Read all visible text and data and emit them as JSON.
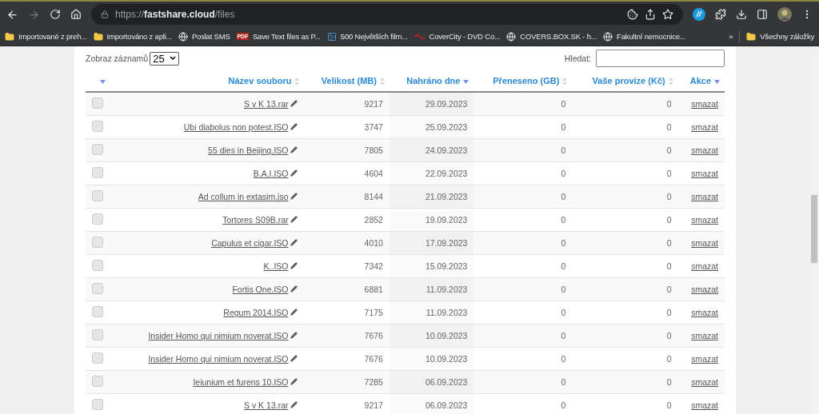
{
  "browser": {
    "url": "https://**fastshare.cloud**/files",
    "bookmarks": [
      {
        "kind": "folder",
        "label": "Importované z preh..."
      },
      {
        "kind": "folder",
        "label": "Importováno z apli..."
      },
      {
        "kind": "globe",
        "label": "Poslat SMS"
      },
      {
        "kind": "pdf",
        "label": "Save Text files as P...",
        "badge": "PDF"
      },
      {
        "kind": "image",
        "label": "500 Největších film..."
      },
      {
        "kind": "logo",
        "label": "CoverCity - DVD Co..."
      },
      {
        "kind": "globe",
        "label": "COVERS.BOX.SK - h..."
      },
      {
        "kind": "globe",
        "label": "Fakultní nemocnice..."
      }
    ],
    "overflow": "»",
    "all_bookmarks": "Všechny záložky"
  },
  "controls": {
    "page_size_label": "Zobraz záznamů",
    "page_size": "25",
    "search_label": "Hledat:"
  },
  "table": {
    "columns": [
      {
        "sorted": true
      },
      {
        "label": "Název souboru",
        "sorted": false
      },
      {
        "label": "Velikost (MB)",
        "sorted": false
      },
      {
        "label": "Nahráno dne",
        "sorted": true
      },
      {
        "label": "Přeneseno (GB)",
        "sorted": false
      },
      {
        "label": "Vaše provize (Kč)",
        "sorted": false
      },
      {
        "label": "Akce",
        "sorted": true
      }
    ],
    "rows": [
      {
        "checked": false,
        "name": "S v K 13.rar",
        "size": "9217",
        "date": "29.09.2023",
        "transferred": "0",
        "commission": "0",
        "action": "smazat"
      },
      {
        "checked": false,
        "name": "Ubi diabolus non potest.ISO",
        "size": "3747",
        "date": "25.09.2023",
        "transferred": "0",
        "commission": "0",
        "action": "smazat"
      },
      {
        "checked": false,
        "name": "55 dies in Beijing.ISO",
        "size": "7805",
        "date": "24.09.2023",
        "transferred": "0",
        "commission": "0",
        "action": "smazat"
      },
      {
        "checked": false,
        "name": "B.A.I.ISO",
        "size": "4604",
        "date": "22.09.2023",
        "transferred": "0",
        "commission": "0",
        "action": "smazat"
      },
      {
        "checked": false,
        "name": "Ad collum in extasim.iso",
        "size": "8144",
        "date": "21.09.2023",
        "transferred": "0",
        "commission": "0",
        "action": "smazat"
      },
      {
        "checked": false,
        "name": "Tortores S09B.rar",
        "size": "2852",
        "date": "19.09.2023",
        "transferred": "0",
        "commission": "0",
        "action": "smazat"
      },
      {
        "checked": false,
        "name": "Capulus et cigar.ISO",
        "size": "4010",
        "date": "17.09.2023",
        "transferred": "0",
        "commission": "0",
        "action": "smazat"
      },
      {
        "checked": false,
        "name": "K..ISO",
        "size": "7342",
        "date": "15.09.2023",
        "transferred": "0",
        "commission": "0",
        "action": "smazat"
      },
      {
        "checked": false,
        "name": "Fortis One.ISO",
        "size": "6881",
        "date": "11.09.2023",
        "transferred": "0",
        "commission": "0",
        "action": "smazat"
      },
      {
        "checked": false,
        "name": "Regum 2014.ISO",
        "size": "7175",
        "date": "11.09.2023",
        "transferred": "0",
        "commission": "0",
        "action": "smazat"
      },
      {
        "checked": false,
        "name": "Insider Homo qui nimium noverat.ISO",
        "size": "7676",
        "date": "10.09.2023",
        "transferred": "0",
        "commission": "0",
        "action": "smazat"
      },
      {
        "checked": false,
        "name": "Insider Homo qui nimium noverat.ISO",
        "size": "7676",
        "date": "10.09.2023",
        "transferred": "0",
        "commission": "0",
        "action": "smazat"
      },
      {
        "checked": false,
        "name": "Ieiunium et furens 10.ISO",
        "size": "7285",
        "date": "06.09.2023",
        "transferred": "0",
        "commission": "0",
        "action": "smazat"
      },
      {
        "checked": false,
        "name": "S v K 13.rar",
        "size": "9217",
        "date": "06.09.2023",
        "transferred": "0",
        "commission": "0",
        "action": "smazat"
      }
    ]
  }
}
